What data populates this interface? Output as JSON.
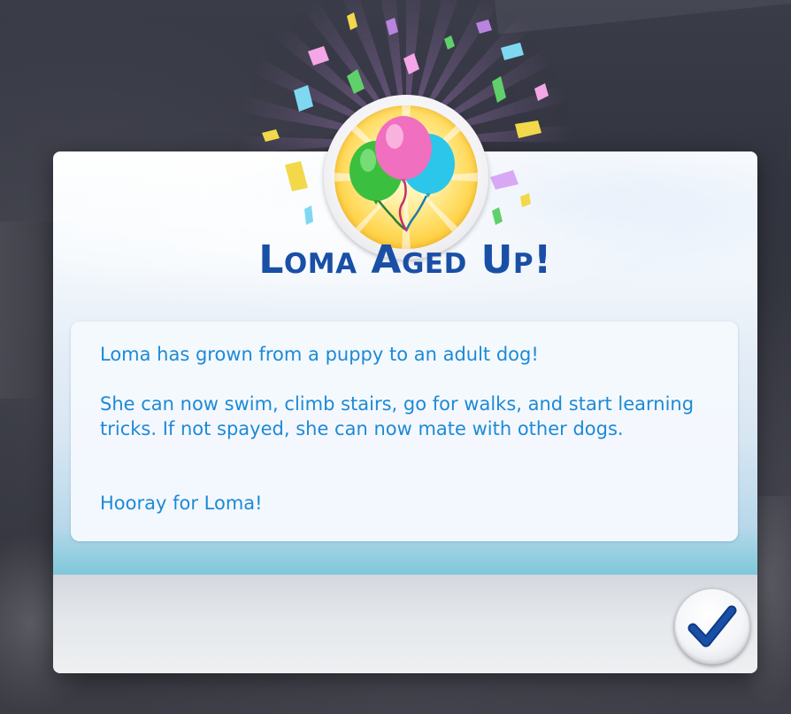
{
  "dialog": {
    "title": "Loma Aged Up!",
    "messages": [
      "Loma has grown from a puppy to an adult dog!",
      "She can now swim, climb stairs, go for walks, and start learning tricks. If not spayed, she can now mate with other dogs.",
      "Hooray for Loma!"
    ],
    "badge_icon": "balloons-icon",
    "confirm_icon": "checkmark-icon"
  },
  "colors": {
    "title": "#1a4fa6",
    "message_text": "#1d8ad6",
    "checkmark": "#1a4fa6",
    "badge_gold": "#ffd54d"
  }
}
